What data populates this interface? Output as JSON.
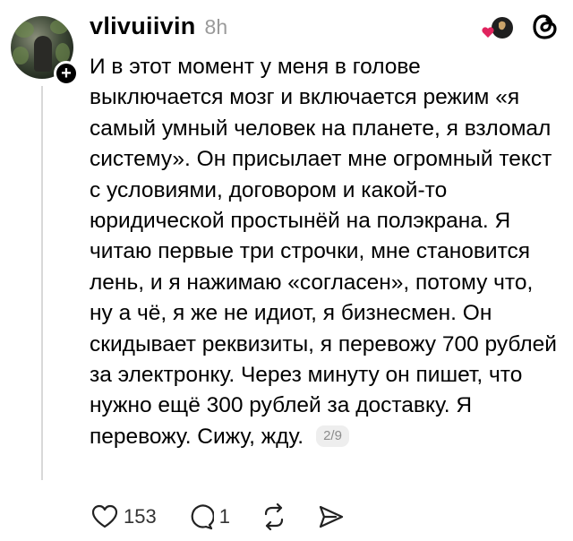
{
  "post": {
    "username": "vlivuiivin",
    "timestamp": "8h",
    "text": "И в этот момент у меня в голове выключается мозг и включается режим «я самый умный человек на планете, я взломал систему». Он присылает мне огромный текст с условиями, договором и какой-то юридической простынёй на полэкрана. Я читаю первые три строчки, мне становится лень, и я нажимаю «согласен», потому что, ну а чё, я же не идиот, я бизнесмен. Он скидывает реквизиты, я перевожу 700 рублей за электронку. Через минуту он пишет, что нужно ещё 300 рублей за доставку. Я перевожу. Сижу, жду.",
    "page_indicator": "2/9"
  },
  "actions": {
    "likes": "153",
    "replies": "1"
  },
  "icons": {
    "avatar": "avatar-photo",
    "follow": "plus-icon",
    "tagged": "heart-avatar-icon",
    "app": "threads-logo-icon",
    "like": "heart-icon",
    "reply": "comment-icon",
    "repost": "repost-icon",
    "share": "send-icon"
  },
  "colors": {
    "text": "#000000",
    "muted": "#9a9a9a",
    "heart_accent": "#e0245e",
    "thread_line": "#d8d8d8"
  }
}
